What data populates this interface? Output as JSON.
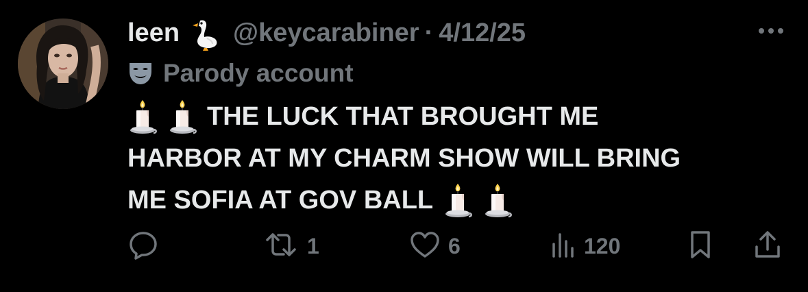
{
  "tweet": {
    "display_name": "leen",
    "name_emoji": "goose-emoji",
    "handle": "@keycarabiner",
    "separator": "·",
    "date": "4/12/25",
    "label_icon": "theater-masks-icon",
    "label": "Parody account",
    "lines": [
      "THE LUCK THAT BROUGHT ME",
      "HARBOR AT MY CHARM SHOW WILL BRING",
      "ME SOFIA AT GOV BALL"
    ],
    "body_emoji": "candle-emoji"
  },
  "actions": {
    "reply": {
      "icon": "reply-icon",
      "count": ""
    },
    "repost": {
      "icon": "repost-icon",
      "count": "1"
    },
    "like": {
      "icon": "heart-icon",
      "count": "6"
    },
    "views": {
      "icon": "views-icon",
      "count": "120"
    },
    "bookmark": {
      "icon": "bookmark-icon"
    },
    "share": {
      "icon": "share-icon"
    }
  },
  "colors": {
    "background": "#000000",
    "primary_text": "#e7e9ea",
    "secondary_text": "#71767b"
  }
}
